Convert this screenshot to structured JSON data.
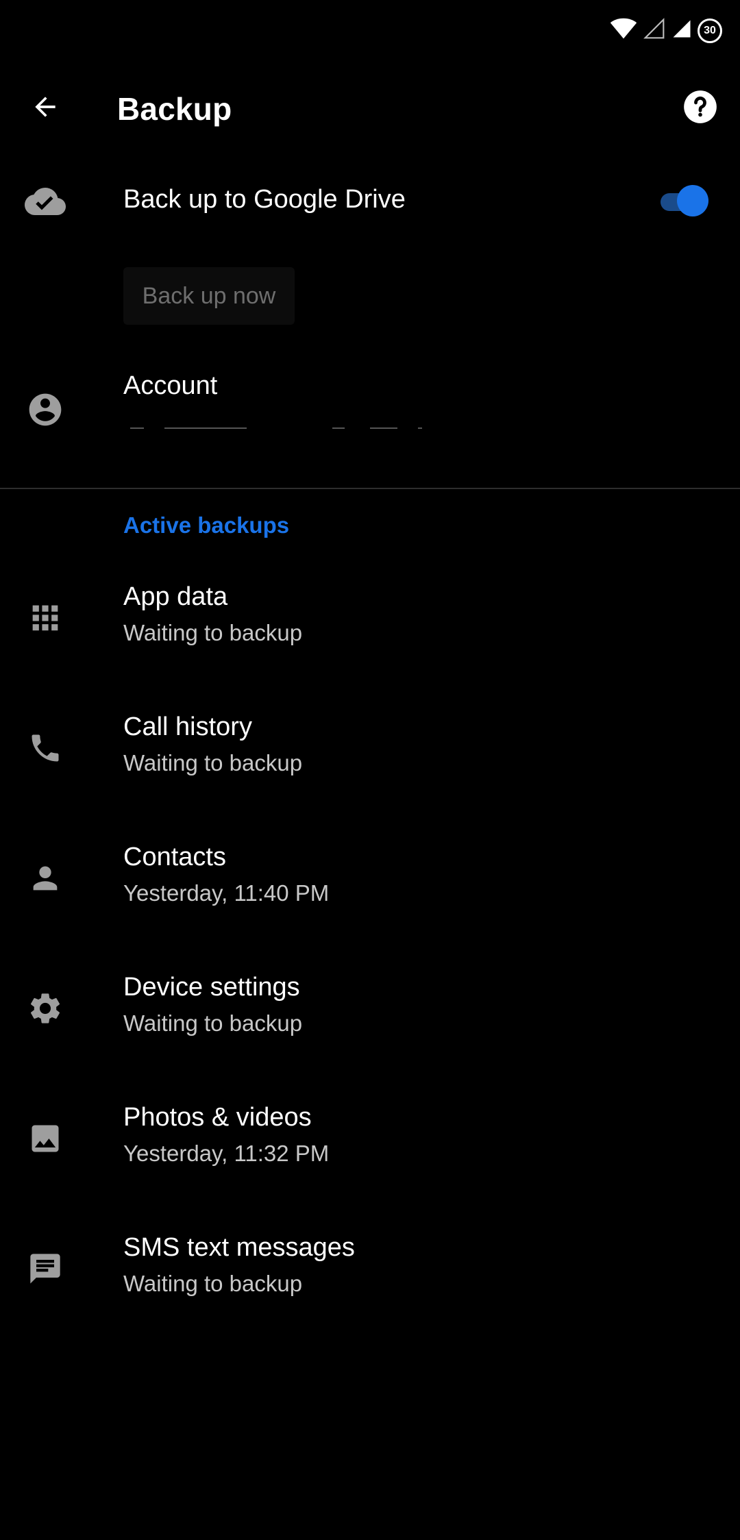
{
  "status_bar": {
    "battery": "30",
    "icons": [
      "wifi-icon",
      "signal-empty-icon",
      "signal-icon",
      "battery-icon"
    ]
  },
  "header": {
    "title": "Backup",
    "back_icon": "arrow-back-icon",
    "help_icon": "help-circle-icon"
  },
  "drive_backup": {
    "label": "Back up to Google Drive",
    "enabled": true,
    "icon": "cloud-done-icon"
  },
  "backup_now": {
    "label": "Back up now"
  },
  "account": {
    "label": "Account",
    "value": "",
    "icon": "account-circle-icon"
  },
  "active_backups": {
    "header": "Active backups",
    "items": [
      {
        "label": "App data",
        "status": "Waiting to backup",
        "icon": "apps-grid-icon"
      },
      {
        "label": "Call history",
        "status": "Waiting to backup",
        "icon": "phone-icon"
      },
      {
        "label": "Contacts",
        "status": "Yesterday, 11:40 PM",
        "icon": "person-icon"
      },
      {
        "label": "Device settings",
        "status": "Waiting to backup",
        "icon": "gear-icon"
      },
      {
        "label": "Photos & videos",
        "status": "Yesterday, 11:32 PM",
        "icon": "image-icon"
      },
      {
        "label": "SMS text messages",
        "status": "Waiting to backup",
        "icon": "message-icon"
      }
    ]
  },
  "colors": {
    "accent": "#1a73e8",
    "background": "#000000",
    "secondary_text": "#c8c8c8",
    "icon": "#9e9e9e"
  }
}
